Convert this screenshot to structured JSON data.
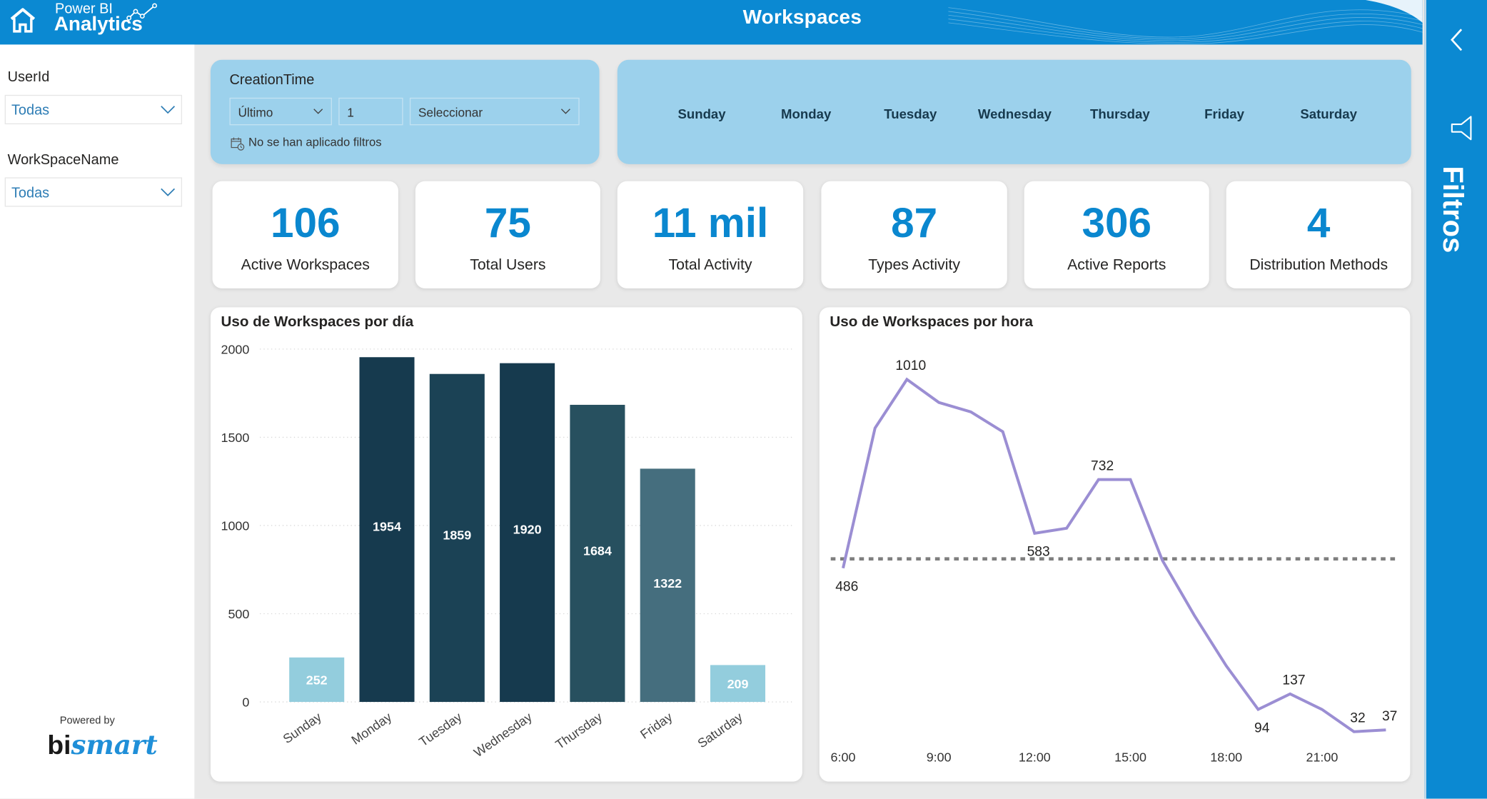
{
  "header": {
    "title": "Workspaces",
    "logo_line1": "Power BI",
    "logo_line2": "Analytics",
    "home_icon": "home-icon",
    "logo_icon": "trend-line-icon"
  },
  "left_panel": {
    "slicers": [
      {
        "label": "UserId",
        "value": "Todas"
      },
      {
        "label": "WorkSpaceName",
        "value": "Todas"
      }
    ],
    "powered_by": "Powered by",
    "brand_bi": "bi",
    "brand_smart": "smart"
  },
  "filters_pane": {
    "label": "Filtros",
    "collapse_icon": "chevron-left-icon",
    "filter_icon": "funnel-icon"
  },
  "creation_time": {
    "label": "CreationTime",
    "mode": "Último",
    "count": "1",
    "unit_placeholder": "Seleccionar",
    "status": "No se han aplicado filtros"
  },
  "day_slicer": {
    "days": [
      "Sunday",
      "Monday",
      "Tuesday",
      "Wednesday",
      "Thursday",
      "Friday",
      "Saturday"
    ]
  },
  "kpis": [
    {
      "value": "106",
      "label": "Active Workspaces"
    },
    {
      "value": "75",
      "label": "Total Users"
    },
    {
      "value": "11 mil",
      "label": "Total Activity"
    },
    {
      "value": "87",
      "label": "Types Activity"
    },
    {
      "value": "306",
      "label": "Active Reports"
    },
    {
      "value": "4",
      "label": "Distribution Methods"
    }
  ],
  "colors": {
    "brand_blue": "#0B89D2",
    "kpi_blue": "#0A87CF",
    "slicer_bg": "#9CD1EC",
    "line_purple": "#9B8ED3"
  },
  "chart_data": [
    {
      "type": "bar",
      "title": "Uso de Workspaces por día",
      "categories": [
        "Sunday",
        "Monday",
        "Tuesday",
        "Wednesday",
        "Thursday",
        "Friday",
        "Saturday"
      ],
      "values": [
        252,
        1954,
        1859,
        1920,
        1684,
        1322,
        209
      ],
      "bar_colors": [
        "#93CDDD",
        "#163A4E",
        "#1B4255",
        "#163A4E",
        "#27505F",
        "#456E7E",
        "#93CDDD"
      ],
      "label_colors": [
        "#ffffff",
        "#ffffff",
        "#ffffff",
        "#ffffff",
        "#ffffff",
        "#ffffff",
        "#ffffff"
      ],
      "xlabel": "",
      "ylabel": "",
      "ylim": [
        0,
        2000
      ],
      "yticks": [
        0,
        500,
        1000,
        1500,
        2000
      ],
      "grid": true,
      "legend": "none"
    },
    {
      "type": "line",
      "title": "Uso de Workspaces por hora",
      "x": [
        6,
        7,
        8,
        9,
        10,
        11,
        12,
        13,
        14,
        15,
        16,
        17,
        18,
        19,
        20,
        21,
        22,
        23
      ],
      "values": [
        486,
        875,
        1010,
        946,
        920,
        865,
        583,
        597,
        732,
        732,
        508,
        355,
        215,
        94,
        137,
        94,
        32,
        37
      ],
      "labeled_points": [
        {
          "x": 6,
          "value": 486,
          "label": "486",
          "pos": "below"
        },
        {
          "x": 8,
          "value": 1010,
          "label": "1010",
          "pos": "above"
        },
        {
          "x": 12,
          "value": 583,
          "label": "583",
          "pos": "below"
        },
        {
          "x": 14,
          "value": 732,
          "label": "732",
          "pos": "above"
        },
        {
          "x": 19,
          "value": 94,
          "label": "94",
          "pos": "below"
        },
        {
          "x": 20,
          "value": 137,
          "label": "137",
          "pos": "above"
        },
        {
          "x": 22,
          "value": 32,
          "label": "32",
          "pos": "above"
        },
        {
          "x": 23,
          "value": 37,
          "label": "37",
          "pos": "above"
        }
      ],
      "average_line": 512,
      "xticks": [
        {
          "x": 6,
          "label": "6:00"
        },
        {
          "x": 9,
          "label": "9:00"
        },
        {
          "x": 12,
          "label": "12:00"
        },
        {
          "x": 15,
          "label": "15:00"
        },
        {
          "x": 18,
          "label": "18:00"
        },
        {
          "x": 21,
          "label": "21:00"
        }
      ],
      "xlabel": "",
      "ylabel": "",
      "ylim": [
        0,
        1100
      ],
      "grid": false,
      "legend": "none"
    }
  ]
}
